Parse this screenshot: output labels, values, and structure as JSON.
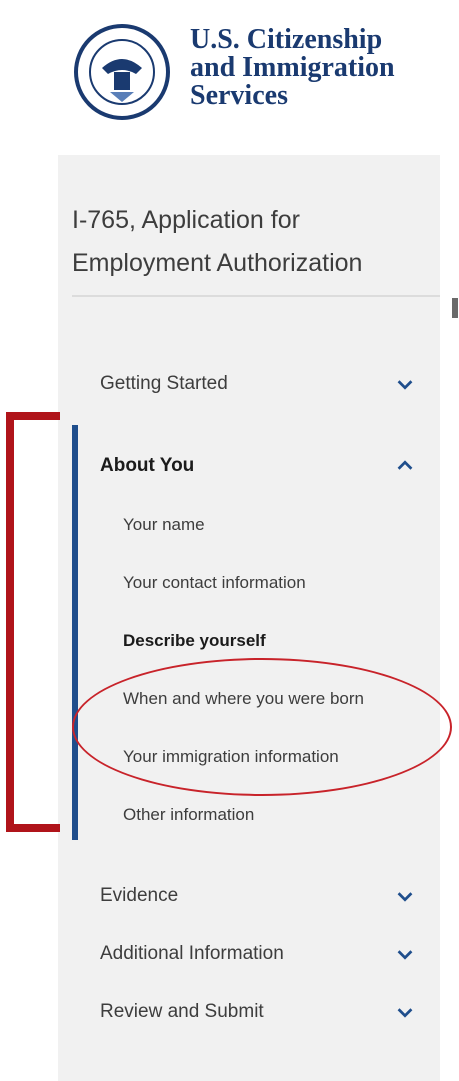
{
  "header": {
    "agency_line1": "U.S. Citizenship",
    "agency_line2": "and Immigration",
    "agency_line3": "Services",
    "seal_icon": "dhs-seal-icon"
  },
  "sidebar": {
    "form_title": "I-765, Application for Employment Authorization",
    "sections": [
      {
        "label": "Getting Started",
        "expanded": false
      },
      {
        "label": "About You",
        "expanded": true
      },
      {
        "label": "Evidence",
        "expanded": false
      },
      {
        "label": "Additional Information",
        "expanded": false
      },
      {
        "label": "Review and Submit",
        "expanded": false
      }
    ],
    "about_you_items": [
      "Your name",
      "Your contact information",
      "Describe yourself",
      "When and where you were born",
      "Your immigration information",
      "Other information"
    ]
  },
  "colors": {
    "brand_navy": "#1a3a70",
    "active_bar": "#1f4e8c",
    "annotation_red": "#b0141a",
    "panel_bg": "#f1f1f1"
  }
}
